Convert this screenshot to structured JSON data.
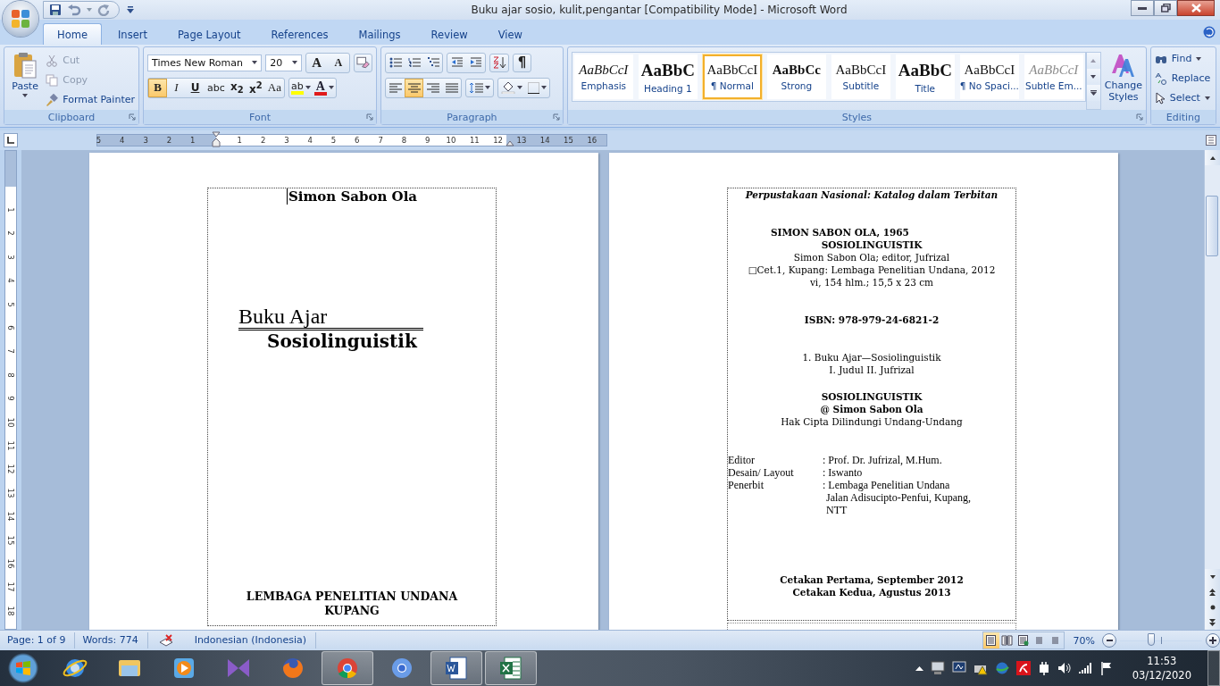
{
  "window": {
    "title": "Buku ajar sosio, kulit,pengantar [Compatibility Mode] - Microsoft Word"
  },
  "tabs": [
    {
      "label": "Home",
      "selected": true
    },
    {
      "label": "Insert",
      "selected": false
    },
    {
      "label": "Page Layout",
      "selected": false
    },
    {
      "label": "References",
      "selected": false
    },
    {
      "label": "Mailings",
      "selected": false
    },
    {
      "label": "Review",
      "selected": false
    },
    {
      "label": "View",
      "selected": false
    }
  ],
  "clipboard": {
    "label": "Clipboard",
    "paste": "Paste",
    "items": [
      {
        "kind": "cut",
        "label": "Cut",
        "disabled": true
      },
      {
        "kind": "copy",
        "label": "Copy",
        "disabled": true
      },
      {
        "kind": "painter",
        "label": "Format Painter",
        "disabled": false
      }
    ]
  },
  "font": {
    "label": "Font",
    "family": "Times New Roman",
    "size": "20",
    "grow": "A",
    "shrink": "A",
    "highlight": "ab",
    "color_glyph": "A",
    "formats": [
      {
        "kind": "bold",
        "glyph": "B",
        "selected": true
      },
      {
        "kind": "italic",
        "glyph": "I",
        "selected": false
      },
      {
        "kind": "underline",
        "glyph": "U",
        "selected": false
      },
      {
        "kind": "strike",
        "glyph": "abc",
        "selected": false
      },
      {
        "kind": "sub",
        "glyph": "x$_{2}$",
        "selected": false
      },
      {
        "kind": "sup",
        "glyph": "x$^{2}$",
        "selected": false
      },
      {
        "kind": "case",
        "glyph": "Aa",
        "selected": false
      }
    ]
  },
  "paragraph": {
    "label": "Paragraph",
    "pilcrow": "¶",
    "alignments": [
      {
        "kind": "left",
        "selected": false
      },
      {
        "kind": "center",
        "selected": true
      },
      {
        "kind": "right",
        "selected": false
      },
      {
        "kind": "justify",
        "selected": false
      }
    ]
  },
  "styles": {
    "label": "Styles",
    "change_styles": "Change Styles",
    "items": [
      {
        "kind": "emphasis",
        "sample": "AaBbCcI",
        "label": "Emphasis",
        "selected": false
      },
      {
        "kind": "heading",
        "sample": "AaBbC",
        "label": "Heading 1",
        "selected": false
      },
      {
        "kind": "normal",
        "sample": "AaBbCcI",
        "label": "¶ Normal",
        "selected": true
      },
      {
        "kind": "strong",
        "sample": "AaBbCc",
        "label": "Strong",
        "selected": false
      },
      {
        "kind": "normal",
        "sample": "AaBbCcI",
        "label": "Subtitle",
        "selected": false
      },
      {
        "kind": "heading",
        "sample": "AaBbC",
        "label": "Title",
        "selected": false
      },
      {
        "kind": "normal",
        "sample": "AaBbCcI",
        "label": "¶ No Spaci...",
        "selected": false
      },
      {
        "kind": "subtle",
        "sample": "AaBbCcI",
        "label": "Subtle Em...",
        "selected": false
      }
    ]
  },
  "editing": {
    "label": "Editing",
    "find": "Find",
    "replace": "Replace",
    "select": "Select"
  },
  "ruler": {
    "left_labels": [
      "5",
      "4",
      "3",
      "2",
      "1"
    ],
    "right_labels": [
      "1",
      "2",
      "3",
      "4",
      "5",
      "6",
      "7",
      "8",
      "9",
      "10",
      "11",
      "12",
      "13",
      "14",
      "15",
      "16"
    ],
    "v_labels": [
      "1",
      "2",
      "3",
      "4",
      "5",
      "6",
      "7",
      "8",
      "9",
      "10",
      "11",
      "12",
      "13",
      "14",
      "15",
      "16",
      "17",
      "18"
    ]
  },
  "left_page": {
    "author": "Simon Sabon Ola",
    "title": "Buku Ajar",
    "subtitle": "Sosiolinguistik",
    "publisher": [
      "LEMBAGA PENELITIAN UNDANA",
      "KUPANG"
    ]
  },
  "right_page": {
    "heading": "Perpustakaan Nasional: Katalog dalam Terbitan",
    "blocks": [
      [
        {
          "kind": "entry",
          "text": "SIMON SABON OLA, 1965"
        },
        {
          "kind": "bold",
          "text": "SOSIOLINGUISTIK"
        },
        {
          "kind": "plain",
          "text": "Simon Sabon Ola; editor, Jufrizal"
        },
        {
          "kind": "plain",
          "text": "□Cet.1, Kupang: Lembaga Penelitian Undana, 2012"
        },
        {
          "kind": "plain",
          "text": "vi, 154 hlm.; 15,5 x 23 cm"
        }
      ],
      [
        {
          "kind": "bold",
          "text": "ISBN: 978-979-24-6821-2"
        }
      ],
      [
        {
          "kind": "plain",
          "text": "1. Buku Ajar—Sosiolinguistik"
        },
        {
          "kind": "plain",
          "text": "I. Judul  II. Jufrizal"
        }
      ],
      [
        {
          "kind": "bold",
          "text": "SOSIOLINGUISTIK"
        },
        {
          "kind": "bold",
          "text": "@ Simon Sabon Ola"
        },
        {
          "kind": "plain",
          "text": "Hak Cipta Dilindungi Undang-Undang"
        }
      ]
    ],
    "credits": [
      {
        "label": "Editor",
        "value": [
          ": Prof. Dr. Jufrizal, M.Hum."
        ]
      },
      {
        "label": "Desain/ Layout",
        "value": [
          ": Iswanto"
        ]
      },
      {
        "label": "Penerbit",
        "value": [
          ": Lembaga Penelitian Undana",
          "Jalan Adisucipto-Penfui,  Kupang,",
          "NTT"
        ]
      }
    ],
    "closing": [
      "Cetakan Pertama, September 2012",
      "Cetakan Kedua, Agustus 2013"
    ]
  },
  "status_bar": {
    "page": "Page: 1 of 9",
    "words": "Words: 774",
    "language": "Indonesian (Indonesia)",
    "views": [
      {
        "kind": "print",
        "selected": true
      },
      {
        "kind": "reading",
        "selected": false
      },
      {
        "kind": "web",
        "selected": false
      },
      {
        "kind": "outline",
        "selected": false
      },
      {
        "kind": "draft",
        "selected": false
      }
    ],
    "zoom": "70%",
    "zoom_slider": {
      "level": 0.38
    }
  },
  "taskbar": {
    "apps": [
      {
        "kind": "ie",
        "running": false
      },
      {
        "kind": "explorer",
        "running": false
      },
      {
        "kind": "media",
        "running": false
      },
      {
        "kind": "vs",
        "running": false
      },
      {
        "kind": "firefox",
        "running": false
      },
      {
        "kind": "chrome",
        "running": true
      },
      {
        "kind": "chromium",
        "running": false
      },
      {
        "kind": "word",
        "running": true
      },
      {
        "kind": "excel",
        "running": true
      }
    ],
    "clock": {
      "time": "11:53",
      "date": "03/12/2020"
    }
  }
}
